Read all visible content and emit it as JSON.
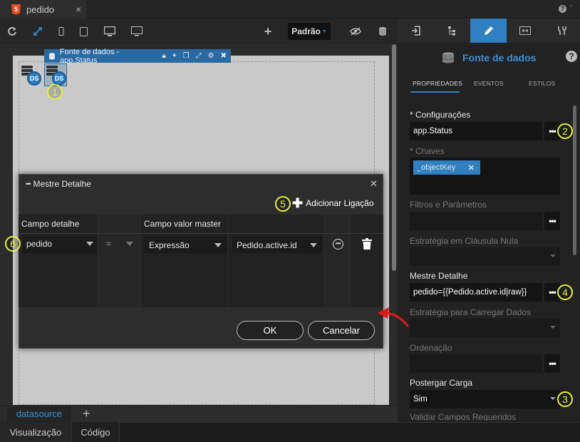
{
  "window": {
    "tab_label": "pedido",
    "tab_close": "×",
    "html5_badge": "5",
    "help_glyph": "?",
    "minimize_glyph": "⁻"
  },
  "toolbar": {
    "device_select": "Padrão",
    "add_glyph": "+"
  },
  "canvas": {
    "datasource_header": "Fonte de dados - app.Status",
    "ds_badge": "DS"
  },
  "bottom": {
    "file_tab": "datasource",
    "add_tab": "+",
    "view_tabs": [
      "Visualização",
      "Código"
    ]
  },
  "right_panel": {
    "title": "Fonte de dados",
    "help": "?",
    "subtabs": [
      "PROPRIEDADES",
      "EVENTOS",
      "ESTILOS"
    ],
    "properties": {
      "config_label": "* Configurações",
      "config_value": "app.Status",
      "keys_label": "* Chaves",
      "key_chip": "_objectKey",
      "chip_remove": "✕",
      "filters_label": "Filtros e Parâmetros",
      "null_strategy_label": "Estratégia em Cláusula Nula",
      "master_detail_label": "Mestre Detalhe",
      "master_detail_value": "pedido={{Pedido.active.id|raw}}",
      "load_strategy_label": "Estratégia para Carregar Dados",
      "order_label": "Ordenação",
      "defer_label": "Postergar Carga",
      "defer_value": "Sim",
      "validate_label": "Validar Campos Requeridos",
      "dots": "•••"
    }
  },
  "dialog": {
    "title": "Mestre Detalhe",
    "menu_dots": "•••",
    "close": "✕",
    "add_link": "Adicionar Ligação",
    "add_plus": "✚",
    "columns": [
      "Campo detalhe",
      "Campo valor master"
    ],
    "row": {
      "detail_field": "pedido",
      "operator": "=",
      "value_type": "Expressão",
      "master_value": "Pedido.active.id"
    },
    "ok": "OK",
    "cancel": "Cancelar"
  },
  "callouts": [
    "1",
    "2",
    "3",
    "4",
    "5",
    "6"
  ],
  "colors": {
    "accent": "#2f7fc1",
    "callout": "#e8ef3c",
    "arrow": "#e01818",
    "html5": "#e44d26"
  }
}
